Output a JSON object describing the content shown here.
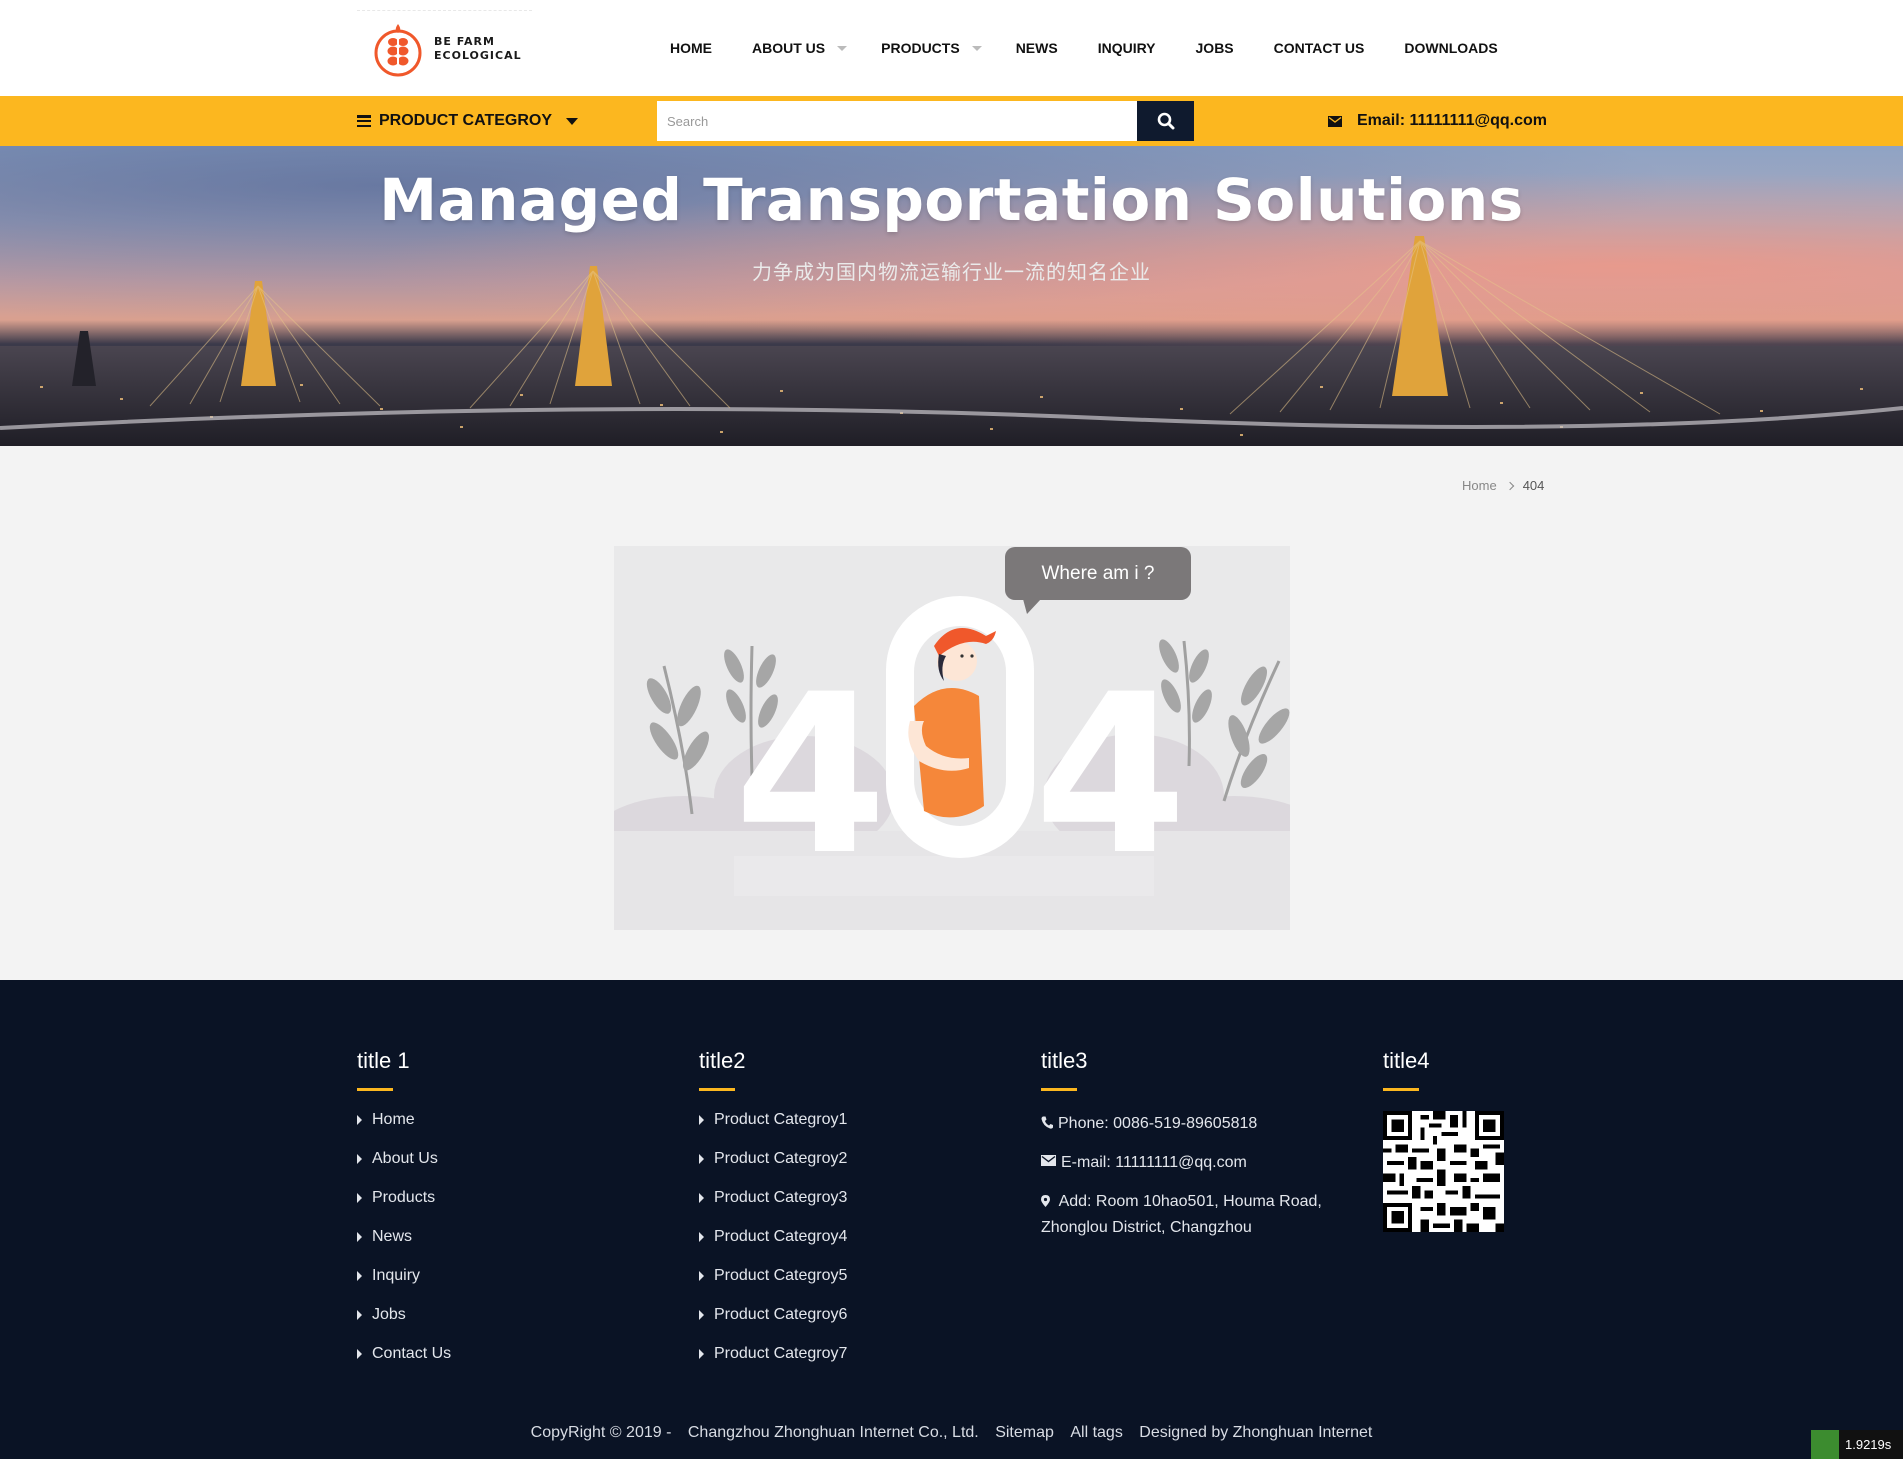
{
  "logo": {
    "line1": "BE FARM",
    "line2": "ECOLOGICAL",
    "color": "#f0582b"
  },
  "nav": {
    "items": [
      {
        "label": "HOME"
      },
      {
        "label": "ABOUT US"
      },
      {
        "label": "PRODUCTS"
      },
      {
        "label": "NEWS"
      },
      {
        "label": "INQUIRY"
      },
      {
        "label": "JOBS"
      },
      {
        "label": "CONTACT US"
      },
      {
        "label": "DOWNLOADS"
      }
    ]
  },
  "topbar": {
    "category_label": "PRODUCT CATEGROY",
    "search_placeholder": "Search",
    "email": "Email: 11111111@qq.com",
    "accent": "#fcb71f",
    "search_icon": "search-icon"
  },
  "banner": {
    "title": "Managed Transportation Solutions",
    "subtitle": "力争成为国内物流运输行业一流的知名企业"
  },
  "breadcrumb": {
    "home": "Home",
    "current": "404"
  },
  "error": {
    "bubble": "Where am i ?",
    "code": "404"
  },
  "footer": {
    "col1": {
      "title": "title 1",
      "items": [
        "Home",
        "About Us",
        "Products",
        "News",
        "Inquiry",
        "Jobs",
        "Contact Us"
      ]
    },
    "col2": {
      "title": "title2",
      "items": [
        "Product Categroy1",
        "Product Categroy2",
        "Product Categroy3",
        "Product Categroy4",
        "Product Categroy5",
        "Product Categroy6",
        "Product Categroy7"
      ]
    },
    "col3": {
      "title": "title3",
      "phone": "Phone: 0086-519-89605818",
      "email": "E-mail: 11111111@qq.com",
      "address": "Add: Room 10hao501, Houma Road, Zhonglou District, Changzhou"
    },
    "col4": {
      "title": "title4"
    },
    "copyright": {
      "prefix": "CopyRight © 2019 -",
      "company": "Changzhou Zhonghuan Internet Co., Ltd.",
      "sitemap": "Sitemap",
      "tags": "All tags",
      "designer": "Designed by Zhonghuan Internet"
    },
    "bg": "#0a1325"
  },
  "timer": "1.9219s"
}
